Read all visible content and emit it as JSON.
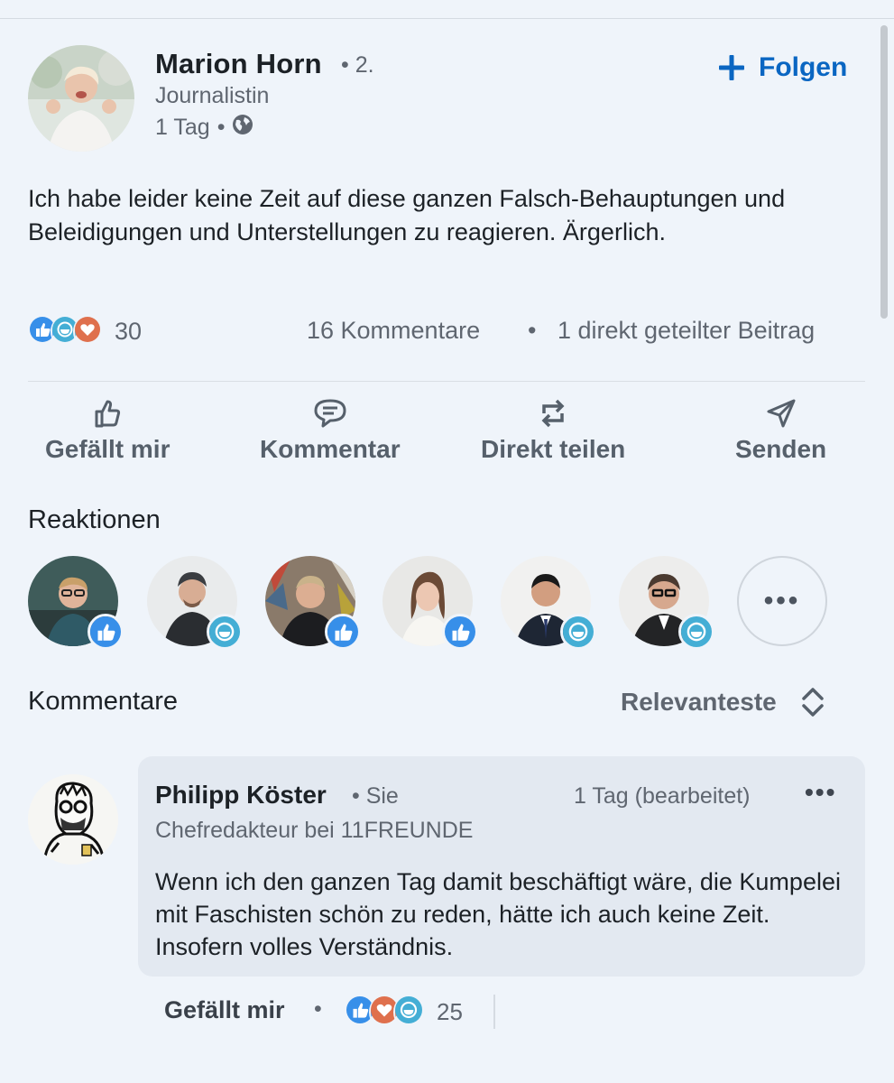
{
  "post": {
    "author_name": "Marion Horn",
    "degree": "• 2.",
    "author_title": "Journalistin",
    "time": "1 Tag",
    "meta_dot": "•",
    "follow_label": "Folgen",
    "text": "Ich habe leider keine Zeit auf diese ganzen Falsch-Behauptungen und Beleidigungen und Unterstellungen zu reagieren. Ärgerlich.",
    "reaction_count": "30",
    "comments_count": "16 Kommentare",
    "separator": "•",
    "shares_count": "1 direkt geteilter Beitrag"
  },
  "actions": {
    "like": "Gefällt mir",
    "comment": "Kommentar",
    "repost": "Direkt teilen",
    "send": "Senden"
  },
  "reactions_section": {
    "title": "Reaktionen",
    "more": "•••",
    "reactors": [
      {
        "reaction": "like-icon"
      },
      {
        "reaction": "funny-icon"
      },
      {
        "reaction": "like-icon"
      },
      {
        "reaction": "like-icon"
      },
      {
        "reaction": "funny-icon"
      },
      {
        "reaction": "funny-icon"
      }
    ]
  },
  "comments_section": {
    "title": "Kommentare",
    "sort_label": "Relevanteste"
  },
  "comment": {
    "author_name": "Philipp Köster",
    "you_label": "• Sie",
    "time": "1 Tag (bearbeitet)",
    "menu": "•••",
    "author_title": "Chefredakteur bei 11FREUNDE",
    "text": "Wenn ich den ganzen Tag damit beschäftigt wäre, die Kumpelei mit Faschisten schön zu reden, hätte ich auch keine Zeit. Insofern volles Verständnis.",
    "like_label": "Gefällt mir",
    "dot": "•",
    "reaction_count": "25"
  },
  "colors": {
    "background": "#eff4fa",
    "accent": "#0a66c2",
    "like": "#378fe9",
    "love": "#df704d",
    "funny": "#44aed5"
  }
}
